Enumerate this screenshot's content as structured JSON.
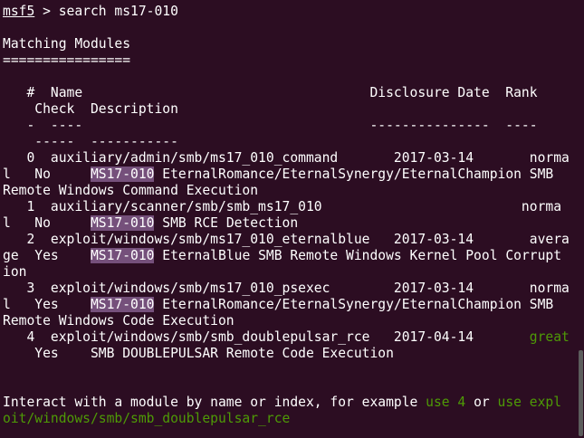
{
  "prompt": {
    "name": "msf5",
    "sep": " > ",
    "command": "search ms17-010"
  },
  "heading": "Matching Modules",
  "heading_rule": "================",
  "columns": {
    "line1": "   #  Name                                    Disclosure Date  Rank",
    "line2": "    Check  Description",
    "dash1": "   -  ----                                    ---------------  ----",
    "dash2": "    -----  -----------"
  },
  "rows": [
    {
      "id": "0",
      "line1": "   0  auxiliary/admin/smb/ms17_010_command       2017-03-14       norma",
      "line2_pre": "l   No     ",
      "tag": "MS17-010",
      "line2_post": " EternalRomance/EternalSynergy/EternalChampion SMB",
      "line3": "Remote Windows Command Execution"
    },
    {
      "id": "1",
      "line1": "   1  auxiliary/scanner/smb/smb_ms17_010                         norma",
      "line2_pre": "l   No     ",
      "tag": "MS17-010",
      "line2_post": " SMB RCE Detection"
    },
    {
      "id": "2",
      "line1": "   2  exploit/windows/smb/ms17_010_eternalblue   2017-03-14       avera",
      "line2_pre": "ge  Yes    ",
      "tag": "MS17-010",
      "line2_post": " EternalBlue SMB Remote Windows Kernel Pool Corrupt",
      "line3": "ion"
    },
    {
      "id": "3",
      "line1": "   3  exploit/windows/smb/ms17_010_psexec        2017-03-14       norma",
      "line2_pre": "l   Yes    ",
      "tag": "MS17-010",
      "line2_post": " EternalRomance/EternalSynergy/EternalChampion SMB",
      "line3": "Remote Windows Code Execution"
    },
    {
      "id": "4",
      "line1_pre": "   4  exploit/windows/smb/smb_doublepulsar_rce   2017-04-14       ",
      "rank": "great",
      "line2": "    Yes    SMB DOUBLEPULSAR Remote Code Execution"
    }
  ],
  "footer": {
    "pre": "Interact with a module by name or index, for example ",
    "cmd1": "use 4",
    "mid": " or ",
    "cmd2a": "use expl",
    "cmd2b": "oit/windows/smb/smb_doublepulsar_rce"
  },
  "colors": {
    "background": "#2c0d22",
    "highlight": "#75507b",
    "green": "#4e9a06",
    "text": "#ffffff"
  }
}
